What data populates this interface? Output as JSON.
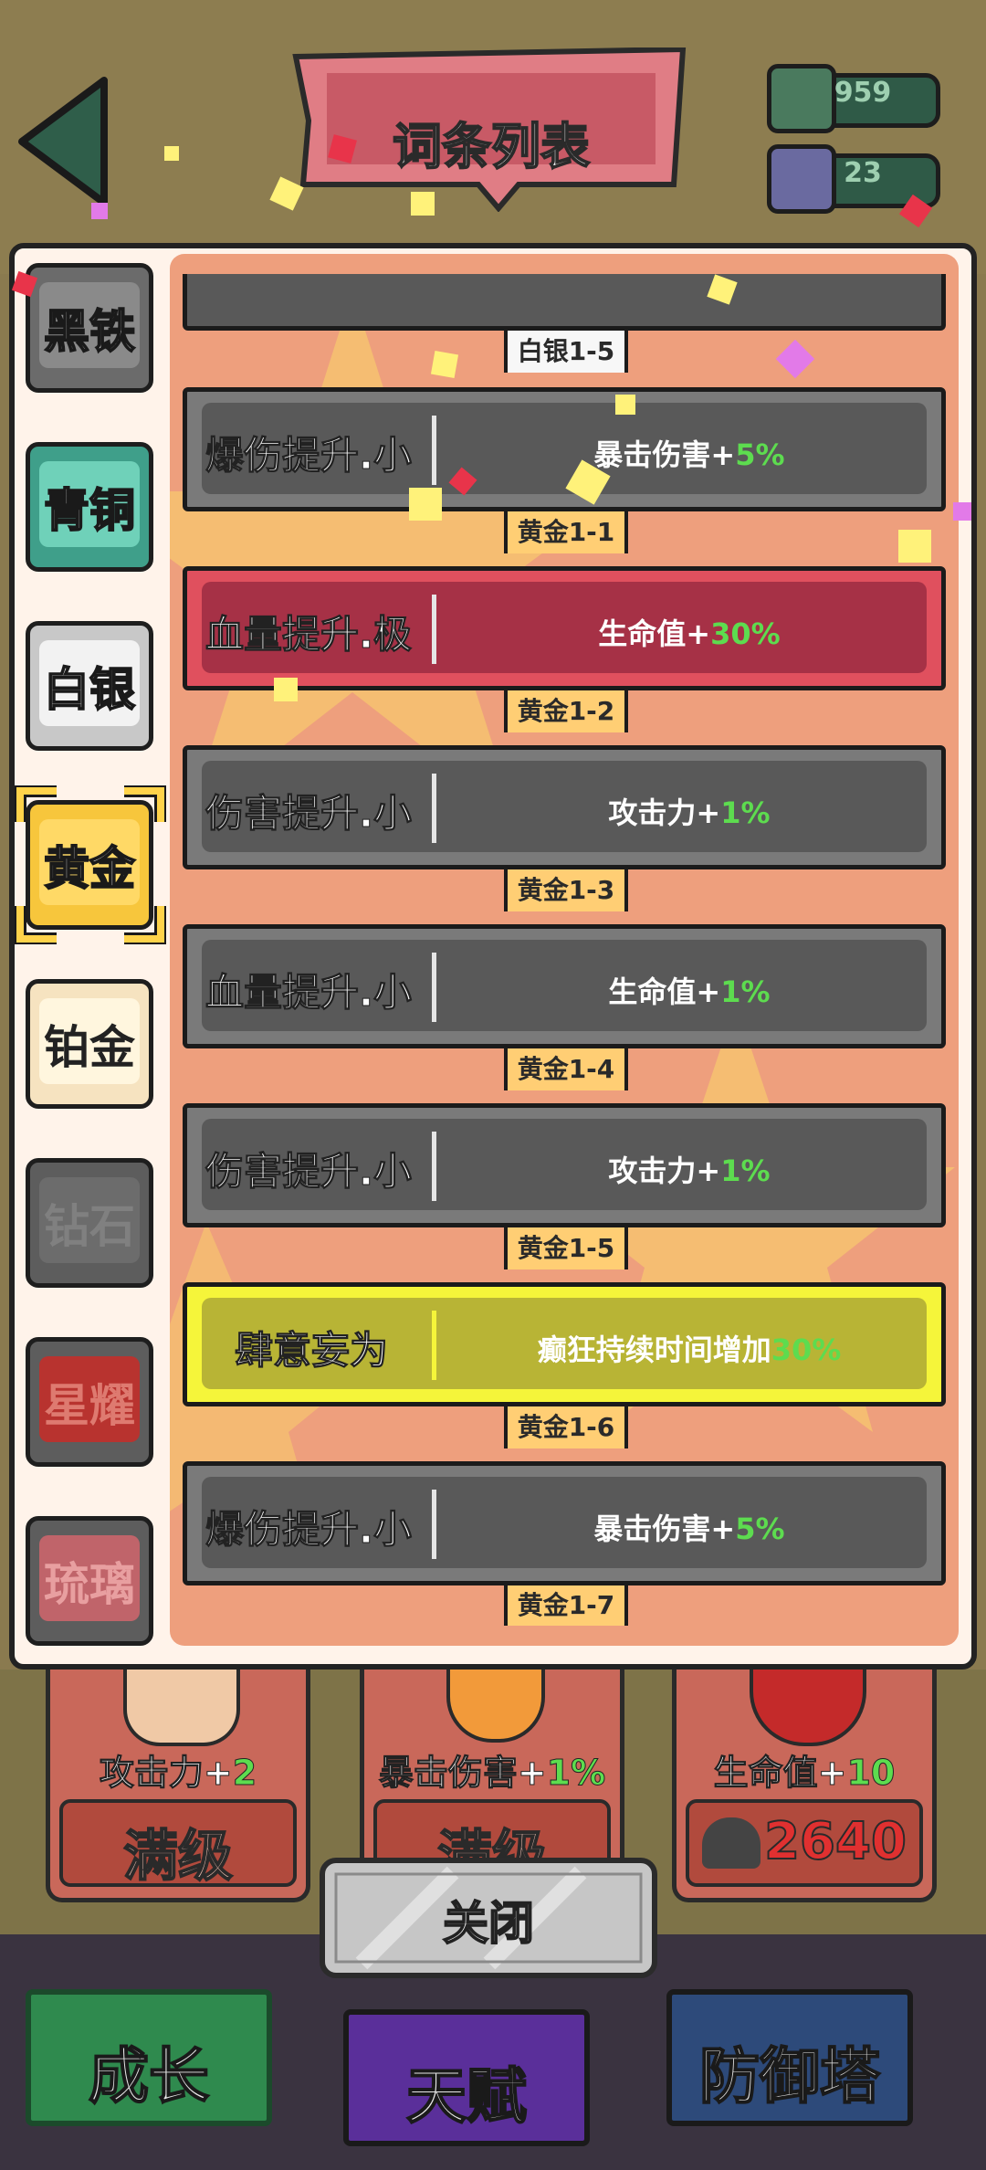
{
  "header": {
    "title": "词条列表",
    "resources": [
      {
        "icon": "ore-pile-icon",
        "value": "959"
      },
      {
        "icon": "crystal-pile-icon",
        "value": "23"
      }
    ]
  },
  "tiers": [
    {
      "label": "黑铁",
      "color": "#8a8a8a"
    },
    {
      "label": "青铜",
      "color": "#6fd1b9"
    },
    {
      "label": "白银",
      "color": "#f2f2f2"
    },
    {
      "label": "黄金",
      "color": "#ffc93c",
      "selected": true
    },
    {
      "label": "铂金",
      "color": "#fff6de"
    },
    {
      "label": "钻石",
      "color": "#6c6c6c"
    },
    {
      "label": "星耀",
      "color": "#b8332f"
    },
    {
      "label": "琉璃",
      "color": "#c0646a"
    }
  ],
  "entries": [
    {
      "tag": "白银1-5",
      "name": "爆伤提升.小",
      "effect": "暴击伤害+",
      "value": "5%",
      "style": "gray"
    },
    {
      "tag": "黄金1-1",
      "name": "血量提升.极",
      "effect": "生命值+",
      "value": "30%",
      "style": "red"
    },
    {
      "tag": "黄金1-2",
      "name": "伤害提升.小",
      "effect": "攻击力+",
      "value": "1%",
      "style": "gray"
    },
    {
      "tag": "黄金1-3",
      "name": "血量提升.小",
      "effect": "生命值+",
      "value": "1%",
      "style": "gray"
    },
    {
      "tag": "黄金1-4",
      "name": "伤害提升.小",
      "effect": "攻击力+",
      "value": "1%",
      "style": "gray"
    },
    {
      "tag": "黄金1-5",
      "name": "肆意妄为",
      "effect": "癫狂持续时间增加",
      "value": "30%",
      "style": "yellow"
    },
    {
      "tag": "黄金1-6",
      "name": "爆伤提升.小",
      "effect": "暴击伤害+",
      "value": "5%",
      "style": "gray"
    }
  ],
  "last_tag": "黄金1-7",
  "upgrade_cards": [
    {
      "text": "攻击力+",
      "value": "2",
      "bottom": "满级"
    },
    {
      "text": "暴击伤害+",
      "value": "1%",
      "bottom": "满级"
    },
    {
      "text": "生命值+",
      "value": "10",
      "bottom": "2640"
    }
  ],
  "close_label": "关闭",
  "nav": [
    {
      "label": "成长",
      "color": "#2f8a4e"
    },
    {
      "label": "天赋",
      "color": "#5a2f9a"
    },
    {
      "label": "防御塔",
      "color": "#2d4a7a"
    }
  ]
}
